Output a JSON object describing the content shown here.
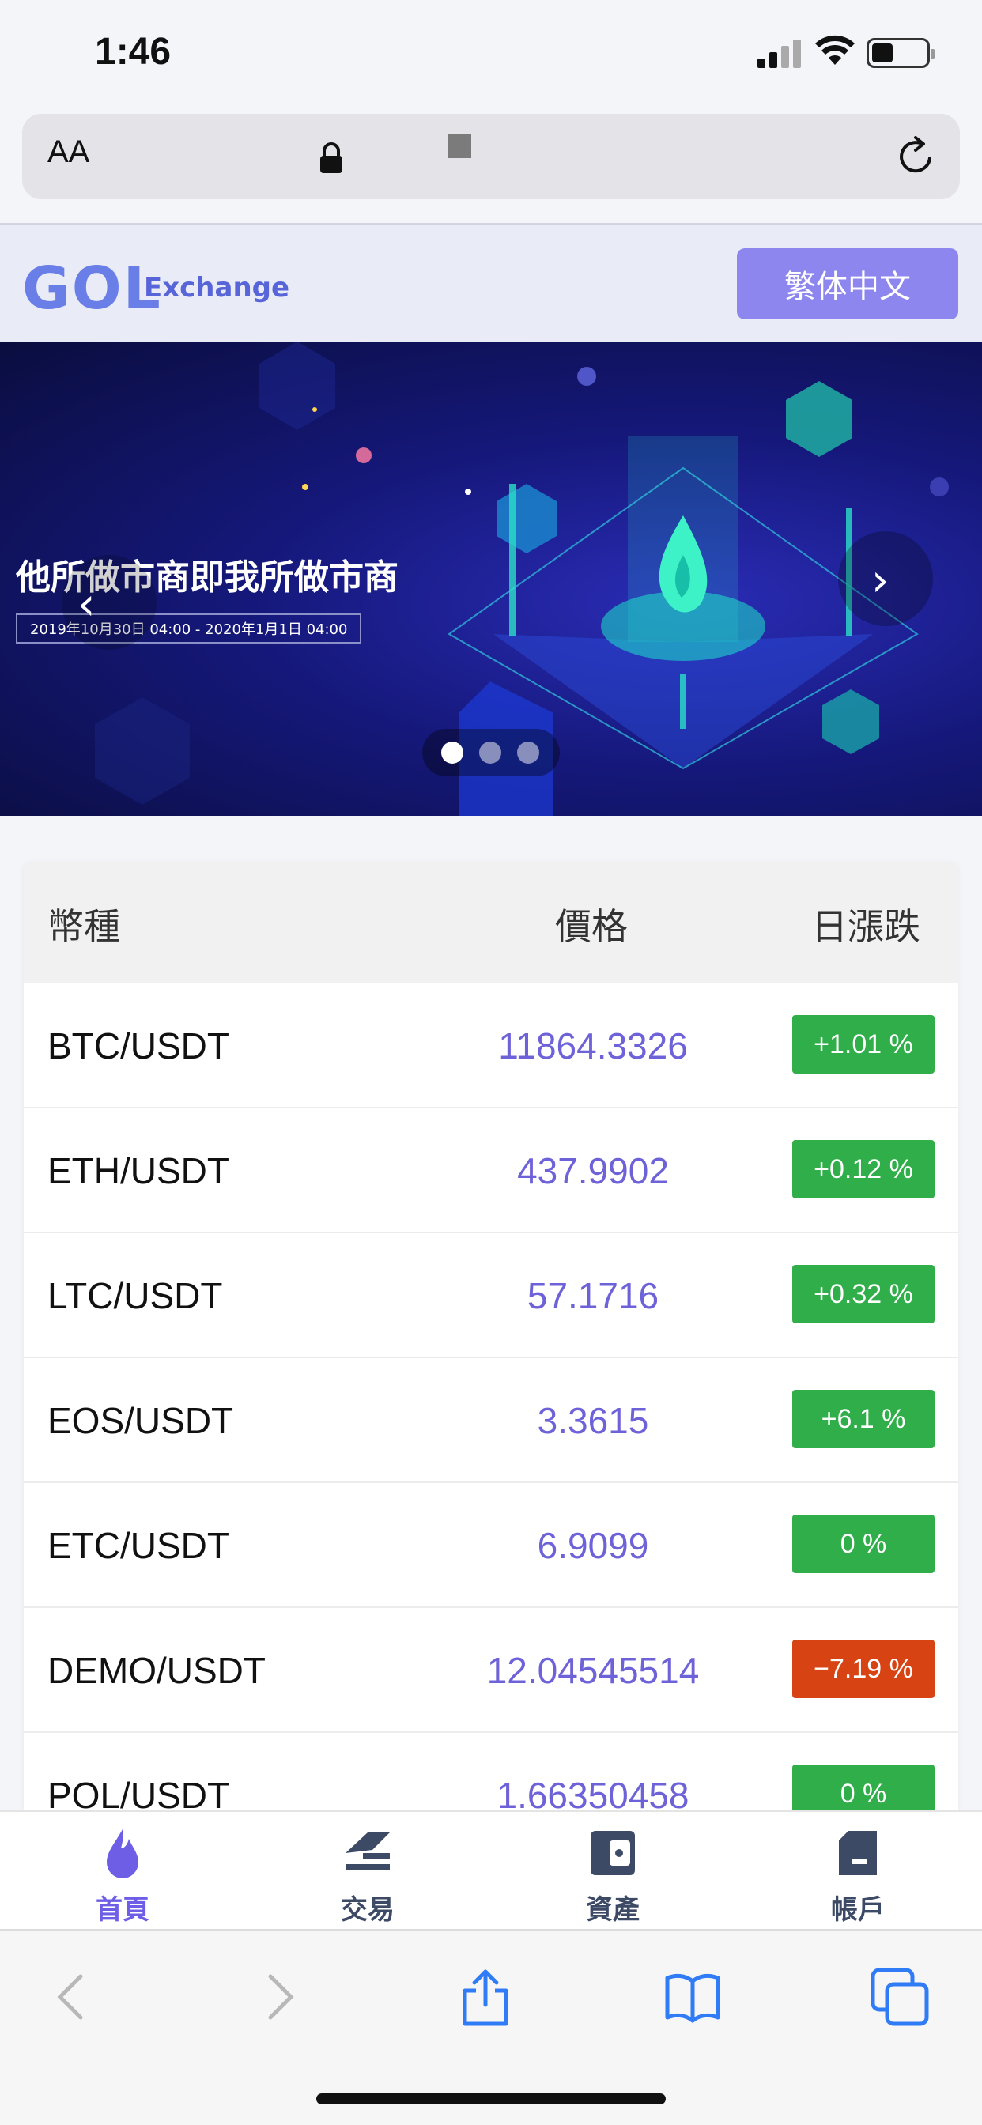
{
  "status_bar": {
    "time": "1:46",
    "icons": [
      "cellular-signal-icon",
      "wifi-icon",
      "battery-icon"
    ]
  },
  "browser": {
    "text_size_label": "AA",
    "icons": [
      "lock-icon",
      "reload-icon"
    ]
  },
  "header": {
    "logo": "GOL",
    "logo_subtitle": "Exchange",
    "language_button": "繁体中文"
  },
  "banner": {
    "title": "他所做市商即我所做市商",
    "date_range": "2019年10月30日 04:00 - 2020年1月1日 04:00",
    "slide_count": 3,
    "active_slide": 1,
    "icons": [
      "chevron-left-icon",
      "chevron-right-icon"
    ]
  },
  "market": {
    "columns": [
      "幣種",
      "價格",
      "日漲跌"
    ],
    "rows": [
      {
        "pair": "BTC/USDT",
        "price": "11864.3326",
        "change": "+1.01 %",
        "direction": "up"
      },
      {
        "pair": "ETH/USDT",
        "price": "437.9902",
        "change": "+0.12 %",
        "direction": "up"
      },
      {
        "pair": "LTC/USDT",
        "price": "57.1716",
        "change": "+0.32 %",
        "direction": "up"
      },
      {
        "pair": "EOS/USDT",
        "price": "3.3615",
        "change": "+6.1 %",
        "direction": "up"
      },
      {
        "pair": "ETC/USDT",
        "price": "6.9099",
        "change": "0 %",
        "direction": "up"
      },
      {
        "pair": "DEMO/USDT",
        "price": "12.04545514",
        "change": "−7.19 %",
        "direction": "down"
      },
      {
        "pair": "POL/USDT",
        "price": "1.66350458",
        "change": "0 %",
        "direction": "up"
      }
    ],
    "colors": {
      "up": "#2fae49",
      "down": "#d84314",
      "price": "#6e62d8"
    }
  },
  "tabs": [
    {
      "label": "首頁",
      "icon": "flame-icon",
      "active": true
    },
    {
      "label": "交易",
      "icon": "trade-icon",
      "active": false
    },
    {
      "label": "資產",
      "icon": "wallet-icon",
      "active": false
    },
    {
      "label": "帳戶",
      "icon": "account-icon",
      "active": false
    }
  ],
  "safari_toolbar": {
    "icons": [
      "back-icon",
      "forward-icon",
      "share-icon",
      "bookmarks-icon",
      "tabs-icon"
    ]
  }
}
